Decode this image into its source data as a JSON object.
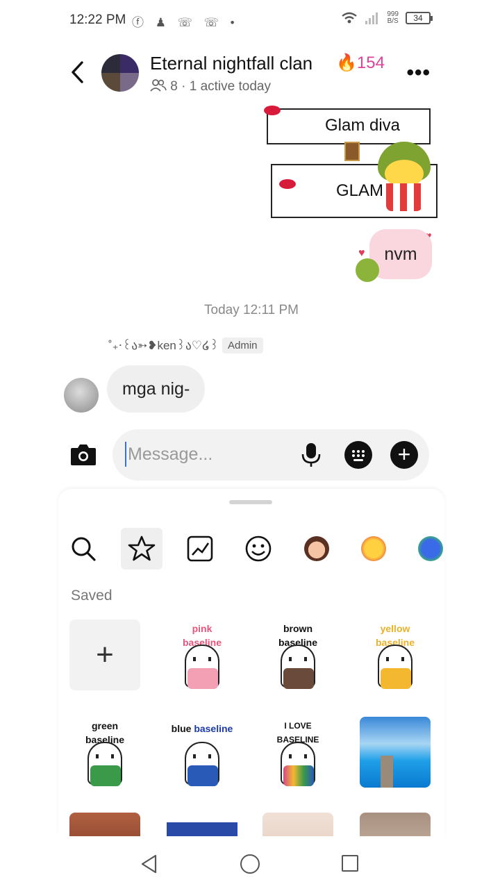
{
  "status_bar": {
    "time": "12:22 PM",
    "left_icons": "ⓕ ♟ ☏ ☏ •",
    "speed_value": "999",
    "speed_unit": "B/S",
    "battery": "34"
  },
  "header": {
    "group_name": "Eternal nightfall clan",
    "streak_count": "154",
    "meta": "8 · 1 active today"
  },
  "messages": {
    "sticker_top_text": "Glam diva",
    "sticker_bottom_text": "GLAM D",
    "outgoing_text": "nvm",
    "timestamp": "Today 12:11 PM",
    "sender_name": "˚₊‧꒰ა➳❥ken꒱ა♡໒꒱",
    "sender_role": "Admin",
    "incoming_text": "mga nig-"
  },
  "composer": {
    "placeholder": "Message..."
  },
  "tray": {
    "section_label": "Saved",
    "stickers": [
      {
        "title_a": "pink",
        "title_b": "baseline",
        "title_color": "#e8557a",
        "jar_color": "#f4a0b4"
      },
      {
        "title_a": "brown",
        "title_b": "baseline",
        "title_color": "#111111",
        "jar_color": "#6a4a3a"
      },
      {
        "title_a": "yellow",
        "title_b": "baseline",
        "title_color": "#e8b22a",
        "jar_color": "#f4b830"
      },
      {
        "title_a": "green",
        "title_b": "baseline",
        "title_color": "#111111",
        "jar_color": "#3a9a4a"
      },
      {
        "title_a": "blue",
        "title_b": "baseline",
        "title_color": "#1a3aa8",
        "jar_color": "#2a5ab8"
      },
      {
        "title_a": "I LOVE",
        "title_b": "BASELINE",
        "title_color": "#111111",
        "jar_color": "#d44a8a"
      }
    ]
  },
  "colors": {
    "streak": "#e0429a",
    "outgoing_bubble": "#fad6de",
    "incoming_bubble": "#efefef",
    "cursor": "#2f6fff"
  }
}
